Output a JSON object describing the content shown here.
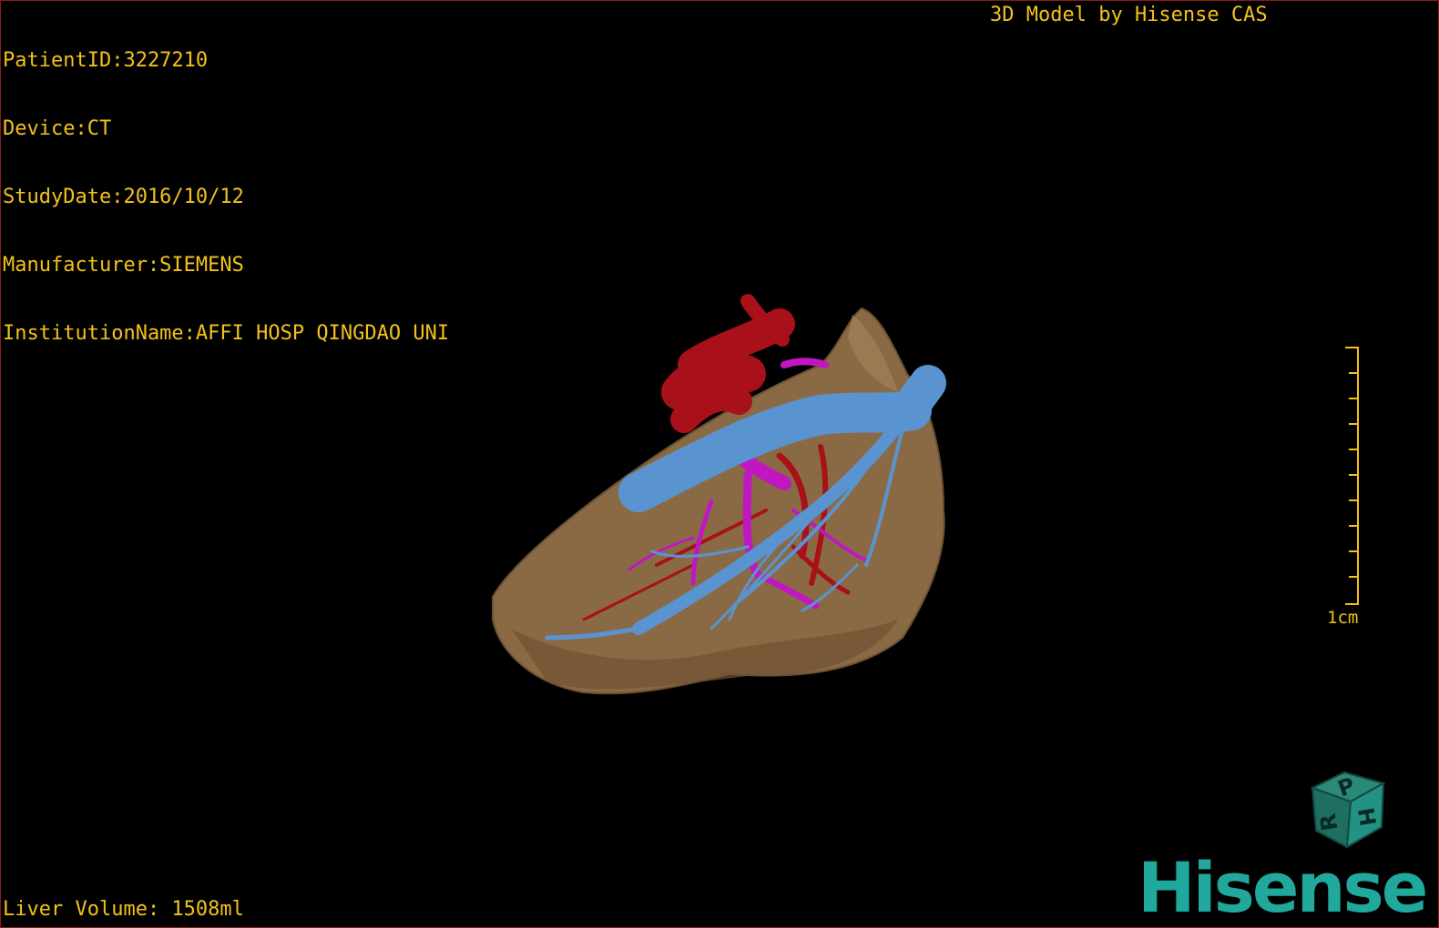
{
  "header": {
    "patient_id": "PatientID:3227210",
    "device": "Device:CT",
    "study_date": "StudyDate:2016/10/12",
    "manufacturer": "Manufacturer:SIEMENS",
    "institution": "InstitutionName:AFFI HOSP QINGDAO UNI"
  },
  "watermark": "3D Model by Hisense CAS",
  "footer": {
    "liver_volume": "Liver Volume: 1508ml"
  },
  "scale_bar": {
    "label": "1cm"
  },
  "orientation_cube": {
    "faces": [
      "P",
      "H",
      "R"
    ]
  },
  "logo": "Hisense",
  "colors": {
    "overlay_text": "#f2c21a",
    "liver": "#8a6a44",
    "portal_vein": "#5a94d0",
    "artery": "#a8101a",
    "hepatic_vessel": "#c018c0",
    "brand": "#1fa89b"
  }
}
